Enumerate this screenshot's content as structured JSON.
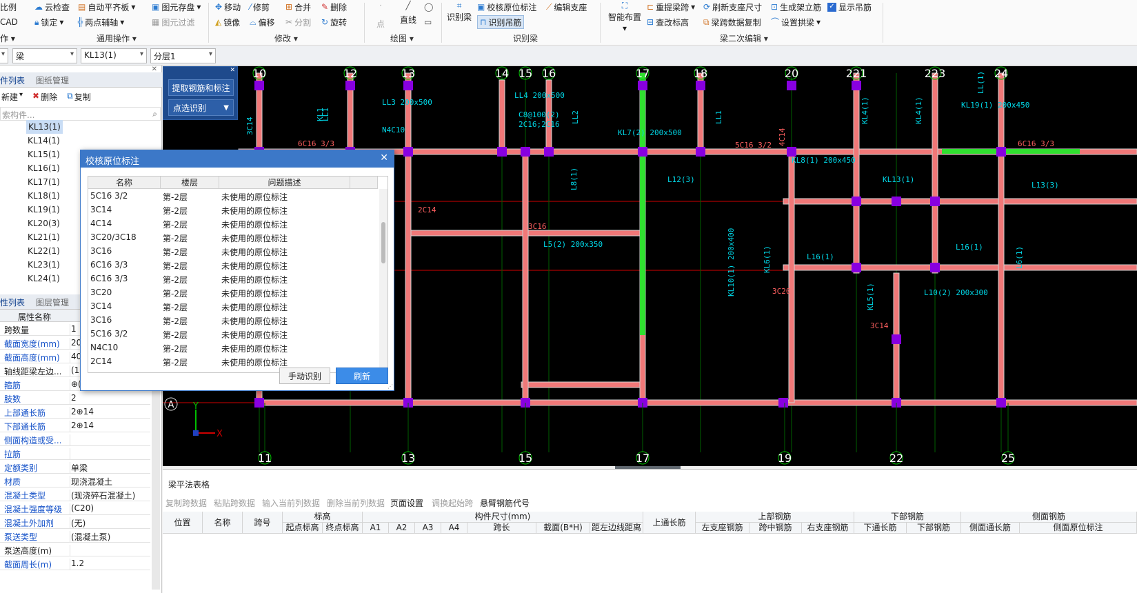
{
  "ribbon": {
    "left_items": [
      "比例",
      "CAD",
      "作 ▾"
    ],
    "common_ops": {
      "cloud_check": "云检查",
      "auto_level": "自动平齐板",
      "element_save": "图元存盘",
      "lock": "锁定",
      "two_point_axis": "两点辅轴",
      "element_filter": "图元过滤",
      "group_label": "通用操作"
    },
    "modify": {
      "move": "移动",
      "trim": "修剪",
      "merge": "合并",
      "delete": "删除",
      "mirror": "镜像",
      "offset": "偏移",
      "split": "分割",
      "rotate": "旋转",
      "group_label": "修改"
    },
    "draw": {
      "point": "点",
      "line": "直线",
      "group_label": "绘图"
    },
    "identify_beam": {
      "identify_beam": "识别梁",
      "check_annotation": "校核原位标注",
      "edit_support": "编辑支座",
      "identify_hanger": "识别吊筋",
      "group_label": "识别梁"
    },
    "secondary_edit": {
      "smart_layout": "智能布置",
      "reextract_span": "重提梁跨",
      "refresh_support": "刷新支座尺寸",
      "gen_stirrup": "生成架立筋",
      "show_hanger": "显示吊筋",
      "modify_elevation": "查改标高",
      "copy_span_data": "梁跨数据复制",
      "set_arch": "设置拱梁",
      "group_label": "梁二次编辑"
    }
  },
  "selector_bar": {
    "type": "梁",
    "element": "KL13(1)",
    "layer": "分层1"
  },
  "left_pane": {
    "tab_active": "件列表",
    "tab_inactive": "图纸管理",
    "new_btn": "新建",
    "delete_btn": "删除",
    "copy_btn": "复制",
    "search_placeholder": "索构件...",
    "components": [
      "KL13(1)",
      "KL14(1)",
      "KL15(1)",
      "KL16(1)",
      "KL17(1)",
      "KL18(1)",
      "KL19(1)",
      "KL20(3)",
      "KL21(1)",
      "KL22(1)",
      "KL23(1)",
      "KL24(1)"
    ],
    "prop_tab_active": "性列表",
    "prop_tab_inactive": "图层管理",
    "prop_header": "属性名称",
    "properties": [
      {
        "name": "跨数量",
        "value": "1",
        "blue": false
      },
      {
        "name": "截面宽度(mm)",
        "value": "20",
        "blue": true
      },
      {
        "name": "截面高度(mm)",
        "value": "40",
        "blue": true
      },
      {
        "name": "轴线距梁左边...",
        "value": "(10",
        "blue": false
      },
      {
        "name": "箍筋",
        "value": "⊕(",
        "blue": true
      },
      {
        "name": "肢数",
        "value": "2",
        "blue": true
      },
      {
        "name": "上部通长筋",
        "value": "2⊕14",
        "blue": true
      },
      {
        "name": "下部通长筋",
        "value": "2⊕14",
        "blue": true
      },
      {
        "name": "侧面构造或受...",
        "value": "",
        "blue": true
      },
      {
        "name": "拉筋",
        "value": "",
        "blue": true
      },
      {
        "name": "定额类别",
        "value": "单梁",
        "blue": true
      },
      {
        "name": "材质",
        "value": "现浇混凝土",
        "blue": true
      },
      {
        "name": "混凝土类型",
        "value": "(现浇碎石混凝土)",
        "blue": true
      },
      {
        "name": "混凝土强度等级",
        "value": "(C20)",
        "blue": true
      },
      {
        "name": "混凝土外加剂",
        "value": "(无)",
        "blue": true
      },
      {
        "name": "泵送类型",
        "value": "(混凝土泵)",
        "blue": true
      },
      {
        "name": "泵送高度(m)",
        "value": "",
        "blue": false
      },
      {
        "name": "截面周长(m)",
        "value": "1.2",
        "blue": true
      }
    ]
  },
  "float_panel": {
    "extract_btn": "提取钢筋和标注",
    "pick_btn": "点选识别"
  },
  "dialog": {
    "title": "校核原位标注",
    "col_name": "名称",
    "col_floor": "楼层",
    "col_desc": "问题描述",
    "rows": [
      {
        "name": "5C16 3/2",
        "floor": "第-2层",
        "desc": "未使用的原位标注"
      },
      {
        "name": "3C14",
        "floor": "第-2层",
        "desc": "未使用的原位标注"
      },
      {
        "name": "4C14",
        "floor": "第-2层",
        "desc": "未使用的原位标注"
      },
      {
        "name": "3C20/3C18",
        "floor": "第-2层",
        "desc": "未使用的原位标注"
      },
      {
        "name": "3C16",
        "floor": "第-2层",
        "desc": "未使用的原位标注"
      },
      {
        "name": "6C16 3/3",
        "floor": "第-2层",
        "desc": "未使用的原位标注"
      },
      {
        "name": "6C16 3/3",
        "floor": "第-2层",
        "desc": "未使用的原位标注"
      },
      {
        "name": "3C20",
        "floor": "第-2层",
        "desc": "未使用的原位标注"
      },
      {
        "name": "3C14",
        "floor": "第-2层",
        "desc": "未使用的原位标注"
      },
      {
        "name": "3C16",
        "floor": "第-2层",
        "desc": "未使用的原位标注"
      },
      {
        "name": "5C16 3/2",
        "floor": "第-2层",
        "desc": "未使用的原位标注"
      },
      {
        "name": "N4C10",
        "floor": "第-2层",
        "desc": "未使用的原位标注"
      },
      {
        "name": "2C14",
        "floor": "第-2层",
        "desc": "未使用的原位标注"
      }
    ],
    "manual_btn": "手动识别",
    "refresh_btn": "刷新"
  },
  "canvas": {
    "top_axes": [
      "10",
      "12",
      "13",
      "14",
      "15",
      "16",
      "17",
      "18",
      "20",
      "221",
      "223",
      "24"
    ],
    "bottom_axes": [
      "11",
      "13",
      "15",
      "17",
      "19",
      "22",
      "25"
    ],
    "axis_a": "A",
    "ucs_x": "X",
    "ucs_y": "Y",
    "labels": [
      "6C16 3/3",
      "5C16 3/2",
      "6C16 3/3",
      "2C14",
      "3C16",
      "3C14",
      "3C20",
      "KL1",
      "KL7(2) 200x500",
      "KL8(1) 200x450",
      "KL13(1)",
      "KL19(1) 200x450",
      "L12(3)",
      "L13(3)",
      "L16(1)",
      "L16(1)",
      "L6(1)",
      "KL4(1)",
      "KL4(1)",
      "L5(2) 200x350",
      "L10(2) 200x300",
      "L8(1)",
      "KL5(1)",
      "LL1",
      "LL1",
      "LL2",
      "LL3 200x500",
      "LL4 200x500",
      "C8@100(2)",
      "N4C10",
      "2C16;2C16",
      "3C14",
      "4C14",
      "KL6(1)",
      "LL(1)",
      "KL10(1) 200x400"
    ],
    "colors": {
      "beam_fill": "#f07878",
      "beam_edge": "#d0d0d0",
      "column": "#8800e0",
      "axis_red": "#d00000",
      "text_cyan": "#00d8e8",
      "text_red": "#ff6060",
      "highlight": "#30e030",
      "axis_circle": "#00c000"
    }
  },
  "bottom_panel": {
    "title": "梁平法表格",
    "toolbar": [
      "复制跨数据",
      "粘贴跨数据",
      "输入当前列数据",
      "删除当前列数据",
      "页面设置",
      "调换起始跨",
      "悬臂钢筋代号"
    ],
    "toolbar_enabled": [
      false,
      false,
      false,
      false,
      true,
      false,
      true
    ],
    "headers_top": [
      "标高",
      "构件尺寸(mm)",
      "上部钢筋",
      "下部钢筋",
      "侧面钢筋"
    ],
    "headers_single": [
      "位置",
      "名称",
      "跨号",
      "上通长筋"
    ],
    "headers_sub": [
      "起点标高",
      "终点标高",
      "A1",
      "A2",
      "A3",
      "A4",
      "跨长",
      "截面(B*H)",
      "距左边线距离",
      "左支座钢筋",
      "跨中钢筋",
      "右支座钢筋",
      "下通长筋",
      "下部钢筋",
      "侧面通长筋",
      "侧面原位标注"
    ]
  }
}
